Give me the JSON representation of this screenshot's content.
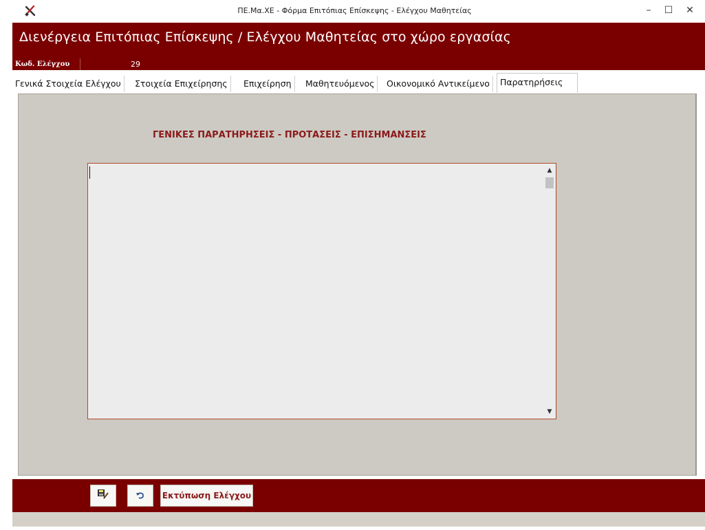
{
  "window": {
    "title": "ΠΕ.Μα.ΧΕ - Φόρμα Επιτόπιας Επίσκεψης - Ελέγχου Μαθητείας",
    "minimize_glyph": "–",
    "maximize_glyph": "☐",
    "close_glyph": "✕"
  },
  "header": {
    "title": "Διενέργεια Επιτόπιας Επίσκεψης / Ελέγχου Μαθητείας στο χώρο εργασίας",
    "code_label": "Κωδ. Ελέγχου",
    "code_value": "29"
  },
  "tabs": [
    {
      "label": "Γενικά Στοιχεία Ελέγχου"
    },
    {
      "label": "Στοιχεία Επιχείρησης"
    },
    {
      "label": "Επιχείρηση"
    },
    {
      "label": "Μαθητευόμενος"
    },
    {
      "label": "Οικονομικό Αντικείμενο"
    },
    {
      "label": "Παρατηρήσεις",
      "active": true
    }
  ],
  "panel": {
    "heading": "ΓΕΝΙΚΕΣ ΠΑΡΑΤΗΡΗΣΕΙΣ - ΠΡΟΤΑΣΕΙΣ - ΕΠΙΣΗΜΑΝΣΕΙΣ",
    "notes_value": ""
  },
  "footer": {
    "save_icon": "save-edit-icon",
    "undo_icon": "undo-icon",
    "print_label": "Εκτύπωση Ελέγχου"
  },
  "colors": {
    "brand": "#7a0000",
    "panel_bg": "#cdc9c3",
    "heading": "#8b1a1a"
  }
}
